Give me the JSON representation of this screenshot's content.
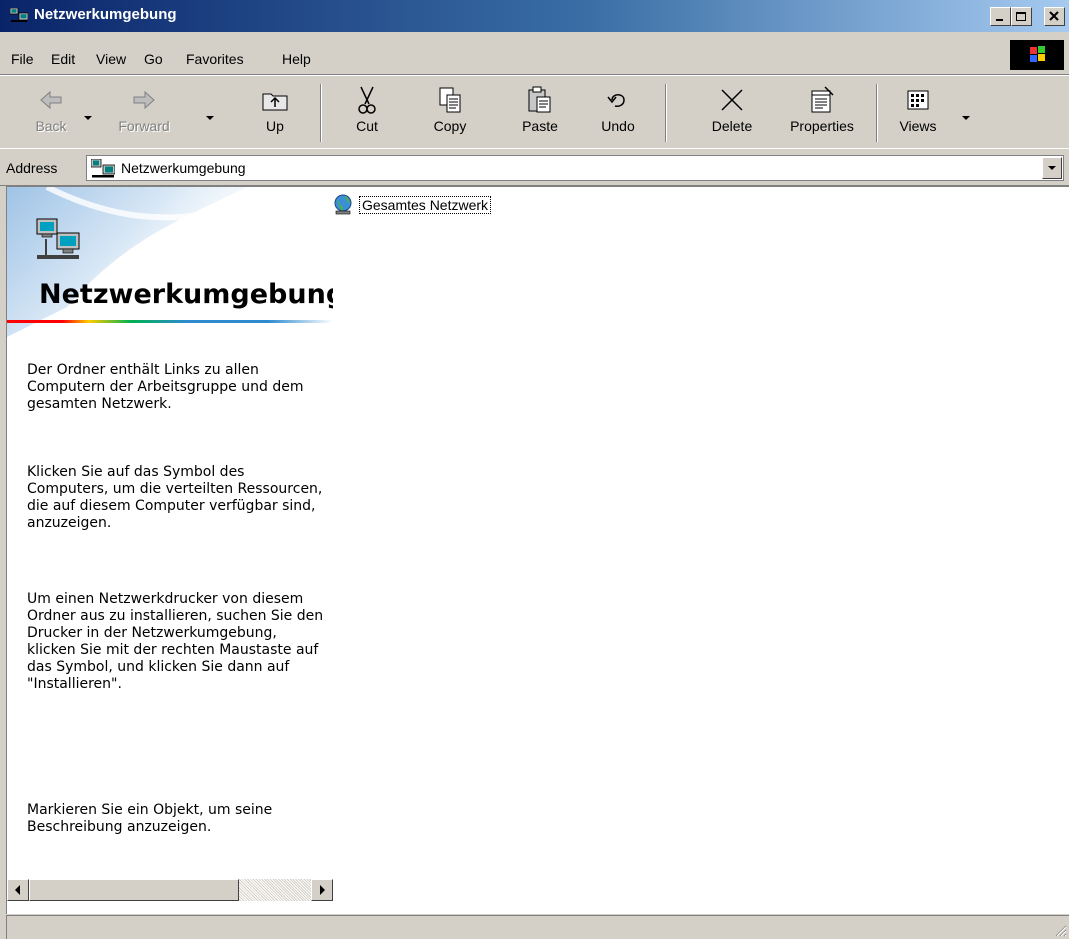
{
  "window": {
    "title": "Netzwerkumgebung"
  },
  "menu": [
    "File",
    "Edit",
    "View",
    "Go",
    "Favorites",
    "Help"
  ],
  "toolbar": {
    "back": "Back",
    "forward": "Forward",
    "up": "Up",
    "cut": "Cut",
    "copy": "Copy",
    "paste": "Paste",
    "undo": "Undo",
    "delete": "Delete",
    "properties": "Properties",
    "views": "Views"
  },
  "address": {
    "label": "Address",
    "value": "Netzwerkumgebung"
  },
  "pane": {
    "title": "Netzwerkumgebung",
    "paragraphs": [
      "Der Ordner enthält Links zu allen Computern der Arbeitsgruppe und dem gesamten Netzwerk.",
      "Klicken Sie auf das Symbol des Computers, um die verteilten Ressourcen, die auf diesem Computer verfügbar sind, anzuzeigen.",
      "Um einen Netzwerkdrucker von diesem Ordner aus zu installieren, suchen Sie den Drucker in der Netzwerkumgebung, klicken Sie mit der rechten Maustaste auf das Symbol, und klicken Sie dann auf \"Installieren\".",
      "Markieren Sie ein Objekt, um seine Beschreibung anzuzeigen."
    ]
  },
  "items": [
    {
      "label": "Gesamtes Netzwerk",
      "icon": "globe-network-icon"
    }
  ],
  "status": {
    "text": ""
  }
}
